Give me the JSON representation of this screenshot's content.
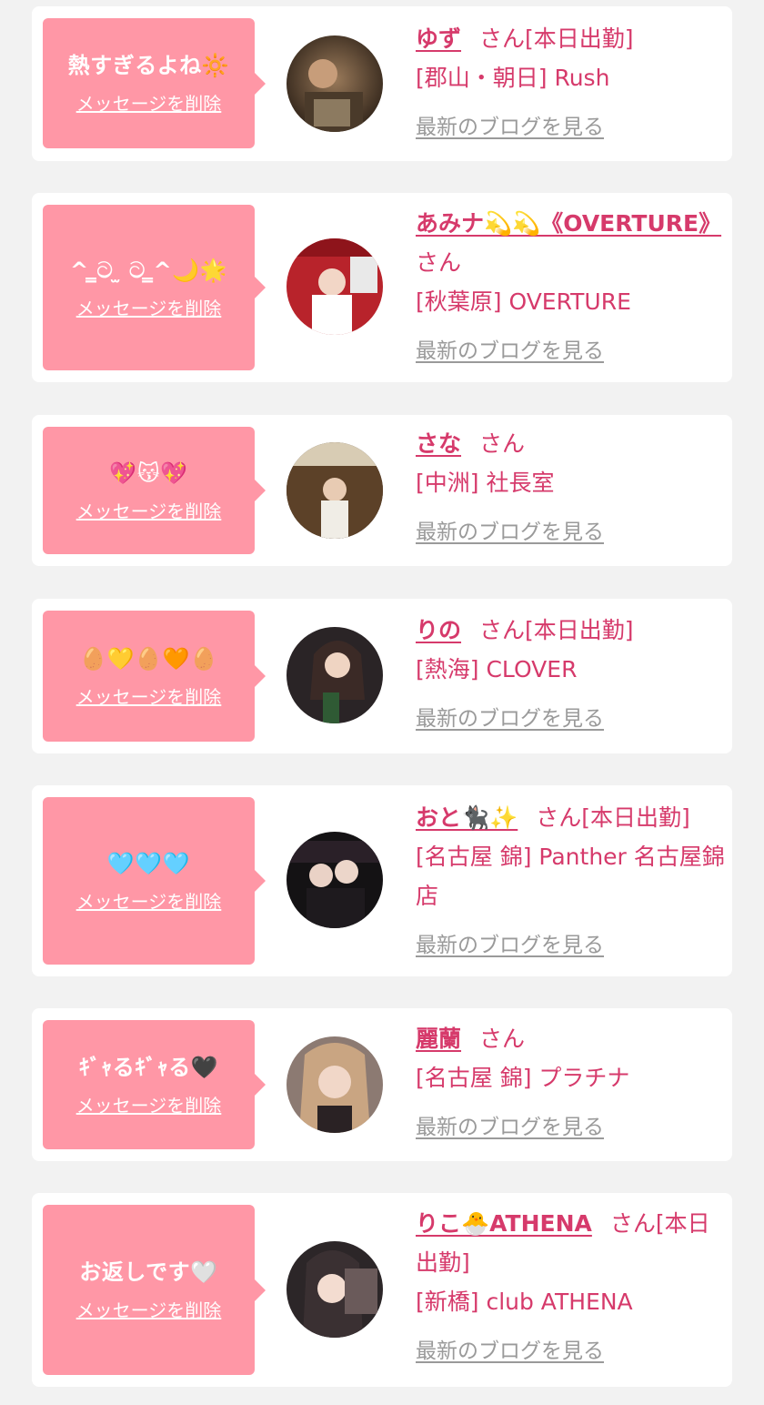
{
  "cards": [
    {
      "message": "熱すぎるよね🔆",
      "delete_label": "メッセージを削除",
      "name": "ゆず",
      "san": "さん[本日出勤]",
      "shop": "[郡山・朝日] Rush",
      "blog_label": "最新のブログを見る"
    },
    {
      "message": "^ ̳ට ̫ ට ̳^🌙🌟",
      "delete_label": "メッセージを削除",
      "name": "あみナ💫💫《OVERTURE》",
      "san": "さん",
      "shop": "[秋葉原] OVERTURE",
      "blog_label": "最新のブログを見る"
    },
    {
      "message": "💖😽💖",
      "delete_label": "メッセージを削除",
      "name": "さな",
      "san": "さん",
      "shop": "[中洲] 社長室",
      "blog_label": "最新のブログを見る"
    },
    {
      "message": "🥚💛🥚🧡🥚",
      "delete_label": "メッセージを削除",
      "name": "りの",
      "san": "さん[本日出勤]",
      "shop": "[熱海] CLOVER",
      "blog_label": "最新のブログを見る"
    },
    {
      "message": "🩵🩵🩵",
      "delete_label": "メッセージを削除",
      "name": "おと🐈‍⬛✨",
      "san": "さん[本日出勤]",
      "shop": "[名古屋 錦] Panther 名古屋錦店",
      "blog_label": "最新のブログを見る"
    },
    {
      "message": "ｷﾞｬるｷﾞｬる🖤",
      "delete_label": "メッセージを削除",
      "name": "麗蘭",
      "san": "さん",
      "shop": "[名古屋 錦] プラチナ",
      "blog_label": "最新のブログを見る"
    },
    {
      "message": "お返しです🤍",
      "delete_label": "メッセージを削除",
      "name": "りこ🐣ATHENA",
      "san": "さん[本日出勤]",
      "shop": "[新橋] club ATHENA",
      "blog_label": "最新のブログを見る"
    }
  ],
  "colors": {
    "bubble": "#ff97a6",
    "accent": "#d63a6b",
    "link_gray": "#9a9a9a",
    "page_bg": "#f2f2f2"
  }
}
